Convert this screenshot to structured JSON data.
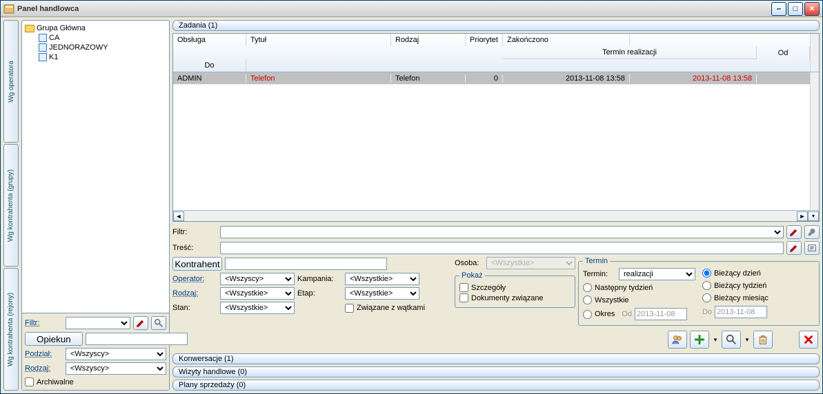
{
  "window": {
    "title": "Panel handlowca"
  },
  "vtabs": [
    "Wg operatora",
    "Wg kontrahenta (grupy)",
    "Wg kontrahenta (rejony)"
  ],
  "tree": {
    "root": "Grupa Główna",
    "items": [
      "CA",
      "JEDNORAZOWY",
      "K1"
    ]
  },
  "left_filter": {
    "filtr_label": "Filtr:",
    "opiekun_btn": "Opiekun",
    "podzial_label": "Podział:",
    "rodzaj_label": "Rodzaj:",
    "wszyscy": "<Wszyscy>",
    "archiwalne": "Archiwalne"
  },
  "sections": {
    "zadania": "Zadania (1)",
    "konwersacje": "Konwersacje (1)",
    "wizyty": "Wizyty handlowe (0)",
    "plany": "Plany sprzedaży (0)"
  },
  "grid": {
    "headers": {
      "obsluga": "Obsługa",
      "tytul": "Tytuł",
      "rodzaj": "Rodzaj",
      "priorytet": "Priorytet",
      "termin_group": "Termin realizacji",
      "od": "Od",
      "do": "Do",
      "zakonczono": "Zakończono"
    },
    "row": {
      "obsluga": "ADMIN",
      "tytul": "Telefon",
      "rodzaj": "Telefon",
      "priorytet": "0",
      "od": "2013-11-08   13:58",
      "do": "2013-11-08   13:58"
    }
  },
  "filters": {
    "filtr_label": "Filtr:",
    "tresc_label": "Treść:",
    "kontrahent_btn": "Kontrahent",
    "osoba_label": "Osoba:",
    "osoba_val": "<Wszystkie>",
    "operator_label": "Operator:",
    "operator_val": "<Wszyscy>",
    "kampania_label": "Kampania:",
    "kampania_val": "<Wszystkie>",
    "rodzaj_label": "Rodzaj:",
    "rodzaj_val": "<Wszystkie>",
    "etap_label": "Etap:",
    "etap_val": "<Wszystkie>",
    "stan_label": "Stan:",
    "stan_val": "<Wszystkie>",
    "zwiazane": "Związane z wątkami"
  },
  "pokaz": {
    "legend": "Pokaż",
    "szczegoly": "Szczegóły",
    "dokumenty": "Dokumenty związane"
  },
  "termin": {
    "legend": "Termin",
    "termin_label": "Termin:",
    "termin_val": "realizacji",
    "biezacy_dzien": "Bieżący dzień",
    "nastepny_tydzien": "Następny tydzień",
    "biezacy_tydzien": "Bieżący tydzień",
    "wszystkie": "Wszystkie",
    "biezacy_miesiac": "Bieżący miesiąc",
    "okres": "Okres",
    "od_label": "Od",
    "do_label": "Do",
    "date": "2013-11-08"
  }
}
